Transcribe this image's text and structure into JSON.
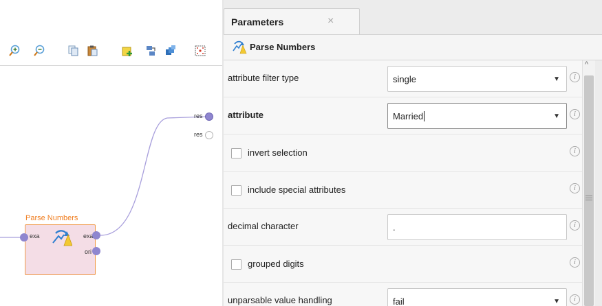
{
  "process": {
    "toolbar_icons": [
      "zoom-in-icon",
      "zoom-out-icon",
      "copy-icon",
      "paste-icon",
      "add-building-block-icon",
      "auto-wire-icon",
      "arrange-operators-icon",
      "fit-to-view-icon"
    ],
    "result_ports": [
      "res",
      "res"
    ],
    "operator": {
      "name": "Parse Numbers",
      "input_ports": [
        "exa"
      ],
      "output_ports": [
        "exa",
        "ori"
      ]
    },
    "colors": {
      "operator_title": "#f07e21",
      "operator_fill": "#f4dde6",
      "wire": "#a89fdc",
      "port": "#8f86cf"
    }
  },
  "panel": {
    "tab_label": "Parameters",
    "close_symbol": "×",
    "operator_name": "Parse Numbers",
    "info_symbol": "i",
    "dropdown_symbol": "▼",
    "scroll_up_symbol": "^",
    "params": {
      "attribute_filter_type": {
        "label": "attribute filter type",
        "value": "single"
      },
      "attribute": {
        "label": "attribute",
        "value": "Married"
      },
      "invert_selection": {
        "label": "invert selection",
        "checked": false
      },
      "include_special_attributes": {
        "label": "include special attributes",
        "checked": false
      },
      "decimal_character": {
        "label": "decimal character",
        "value": "."
      },
      "grouped_digits": {
        "label": "grouped digits",
        "checked": false
      },
      "unparsable_value_handling": {
        "label": "unparsable value handling",
        "value": "fail"
      }
    }
  }
}
